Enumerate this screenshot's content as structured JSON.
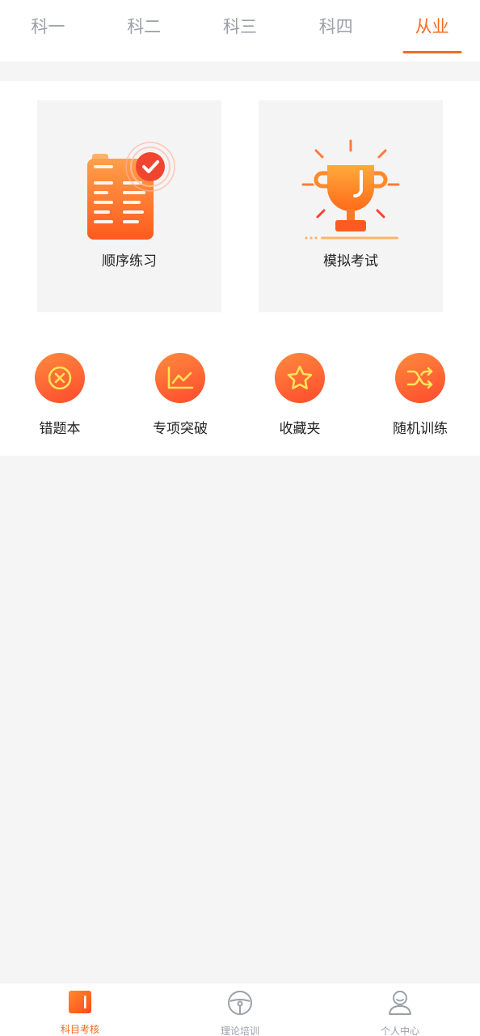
{
  "tabs": [
    {
      "label": "科一",
      "active": false
    },
    {
      "label": "科二",
      "active": false
    },
    {
      "label": "科三",
      "active": false
    },
    {
      "label": "科四",
      "active": false
    },
    {
      "label": "从业",
      "active": true
    }
  ],
  "cards": {
    "sequential": {
      "label": "顺序练习",
      "icon": "checklist-icon"
    },
    "mock_exam": {
      "label": "模拟考试",
      "icon": "trophy-icon"
    }
  },
  "tools": [
    {
      "label": "错题本",
      "icon": "close-circle-icon"
    },
    {
      "label": "专项突破",
      "icon": "chart-icon"
    },
    {
      "label": "收藏夹",
      "icon": "star-icon"
    },
    {
      "label": "随机训练",
      "icon": "shuffle-icon"
    }
  ],
  "bottom_nav": [
    {
      "label": "科目考核",
      "icon": "book-icon",
      "active": true
    },
    {
      "label": "理论培训",
      "icon": "steering-wheel-icon",
      "active": false
    },
    {
      "label": "个人中心",
      "icon": "user-icon",
      "active": false
    }
  ],
  "colors": {
    "accent": "#f26b21",
    "inactive": "#9aa0a8"
  }
}
